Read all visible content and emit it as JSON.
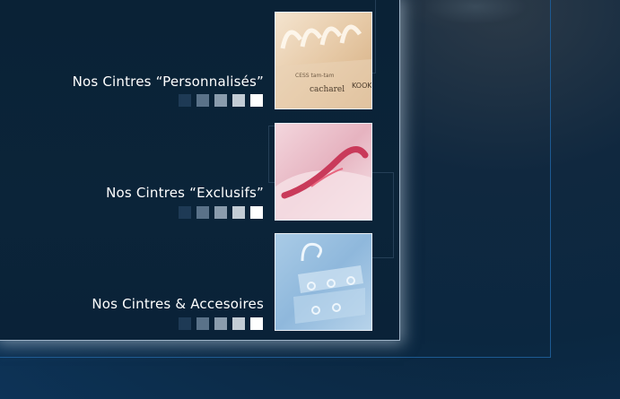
{
  "items": [
    {
      "label": "Nos Cintres “Personnalisés”",
      "image": "personalized-hangers-photo",
      "brand_marks": [
        "cacharel",
        "KOOK",
        "CESS tam-tam"
      ]
    },
    {
      "label": "Nos Cintres “Exclusifs”",
      "image": "exclusive-hangers-photo"
    },
    {
      "label": "Nos Cintres & Accesoires",
      "image": "hangers-accessories-photo"
    }
  ],
  "square_colors": [
    "#1e3a55",
    "#5a7289",
    "#8a9cad",
    "#c3ccd5",
    "#ffffff"
  ],
  "colors": {
    "background": "#0b2740",
    "panel": "#0a2236",
    "frame": "#1d5a92",
    "text": "#ffffff"
  }
}
